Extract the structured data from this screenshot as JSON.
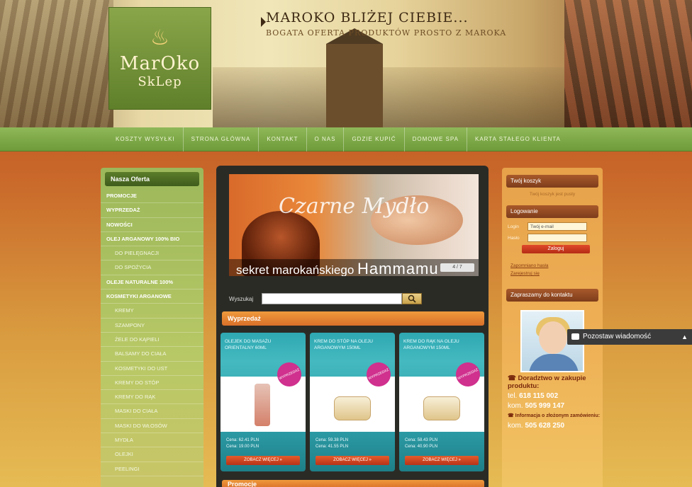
{
  "header": {
    "tagline_title": "MAROKO BLIŻEJ CIEBIE...",
    "tagline_sub": "BOGATA OFERTA PRODUKTÓW PROSTO Z MAROKA",
    "logo_line1": "MarOko",
    "logo_line2": "SkLep"
  },
  "nav": [
    "KOSZTY WYSYŁKI",
    "STRONA GŁÓWNA",
    "KONTAKT",
    "O NAS",
    "GDZIE KUPIĆ",
    "DOMOWE SPA",
    "KARTA STAŁEGO KLIENTA"
  ],
  "left": {
    "title": "Nasza Oferta",
    "items": [
      {
        "label": "PROMOCJE",
        "sub": false
      },
      {
        "label": "WYPRZEDAŻ",
        "sub": false
      },
      {
        "label": "NOWOŚCI",
        "sub": false
      },
      {
        "label": "OLEJ ARGANOWY 100% BIO",
        "sub": false
      },
      {
        "label": "DO PIELĘGNACJI",
        "sub": true
      },
      {
        "label": "DO SPOŻYCIA",
        "sub": true
      },
      {
        "label": "OLEJE NATURALNE 100%",
        "sub": false
      },
      {
        "label": "KOSMETYKI ARGANOWE",
        "sub": false
      },
      {
        "label": "KREMY",
        "sub": true
      },
      {
        "label": "SZAMPONY",
        "sub": true
      },
      {
        "label": "ŻELE DO KĄPIELI",
        "sub": true
      },
      {
        "label": "BALSAMY DO CIAŁA",
        "sub": true
      },
      {
        "label": "KOSMETYKI DO UST",
        "sub": true
      },
      {
        "label": "KREMY DO STÓP",
        "sub": true
      },
      {
        "label": "KREMY DO RĄK",
        "sub": true
      },
      {
        "label": "MASKI DO CIAŁA",
        "sub": true
      },
      {
        "label": "MASKI DO WŁOSÓW",
        "sub": true
      },
      {
        "label": "MYDŁA",
        "sub": true
      },
      {
        "label": "OLEJKI",
        "sub": true
      },
      {
        "label": "PEELINGI",
        "sub": true
      }
    ]
  },
  "center": {
    "banner_title": "Czarne Mydło",
    "banner_caption_small": "sekret marokańskiego",
    "banner_caption_big": "Hammamu",
    "banner_pager": "4 / 7",
    "search_label": "Wyszukaj",
    "search_value": "",
    "section_sale": "Wyprzedaż",
    "section_promo": "Promocje",
    "products": [
      {
        "name": "OLEJEK DO MASAŻU ORIENTALNY 60ML",
        "badge": "WYPRZEDAŻ",
        "price_old": "Cena: 62.41 PLN",
        "price_new": "Cena: 19.00 PLN",
        "button": "ZOBACZ WIĘCEJ »",
        "img": "bottle"
      },
      {
        "name": "KREM DO STÓP NA OLEJU ARGANOWYM 150ML",
        "badge": "WYPRZEDAŻ",
        "price_old": "Cena: 59.38 PLN",
        "price_new": "Cena: 41.55 PLN",
        "button": "ZOBACZ WIĘCEJ »",
        "img": "jar"
      },
      {
        "name": "KREM DO RĄK NA OLEJU ARGANOWYM 150ML",
        "badge": "WYPRZEDAŻ",
        "price_old": "Cena: 58.43 PLN",
        "price_new": "Cena: 40.90 PLN",
        "button": "ZOBACZ WIĘCEJ »",
        "img": "jar"
      }
    ]
  },
  "right": {
    "cart_title": "Twój koszyk",
    "cart_empty": "Twój koszyk jest pusty",
    "login_title": "Logowanie",
    "login_label": "Login",
    "login_placeholder": "Twój e-mail",
    "password_label": "Hasło",
    "login_button": "Zaloguj",
    "forgot_link": "Zapomniano hasła",
    "register_link": "Zarejestruj się",
    "contact_title": "Zapraszamy do kontaktu",
    "advice_label": "☎ Doradztwo w zakupie produktu:",
    "tel_label": "tel.",
    "tel_value": "618 115 002",
    "kom_label": "kom.",
    "kom_value": "505 999 147",
    "order_info": "☎ Informacja o złożonym zamówieniu:",
    "kom2_label": "kom.",
    "kom2_value": "505 628 250"
  },
  "chat": {
    "label": "Pozostaw wiadomość",
    "caret": "▲"
  }
}
